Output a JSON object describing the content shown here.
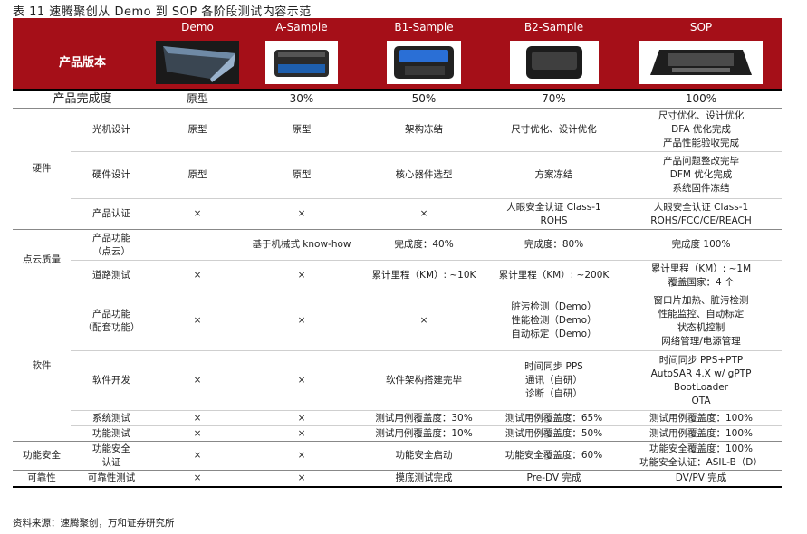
{
  "title": "表 11   速腾聚创从 Demo 到 SOP 各阶段测试内容示范",
  "header": {
    "corner": "产品版本",
    "versions": [
      "Demo",
      "A-Sample",
      "B1-Sample",
      "B2-Sample",
      "SOP"
    ]
  },
  "completion": {
    "label": "产品完成度",
    "values": [
      "原型",
      "30%",
      "50%",
      "70%",
      "100%"
    ]
  },
  "groups": {
    "hardware": "硬件",
    "pointcloud": "点云质量",
    "software": "软件",
    "safety": "功能安全",
    "reliability": "可靠性"
  },
  "rows": {
    "optical": {
      "label": "光机设计",
      "c": [
        "原型",
        "原型",
        "架构冻结",
        "尺寸优化、设计优化"
      ],
      "sop": [
        "尺寸优化、设计优化",
        "DFA 优化完成",
        "产品性能验收完成"
      ]
    },
    "hwdesign": {
      "label": "硬件设计",
      "c": [
        "原型",
        "原型",
        "核心器件选型",
        "方案冻结"
      ],
      "sop": [
        "产品问题整改完毕",
        "DFM 优化完成",
        "系统固件冻结"
      ]
    },
    "cert": {
      "label": "产品认证",
      "c": [
        "×",
        "×",
        "×"
      ],
      "b2": [
        "人眼安全认证 Class-1",
        "ROHS"
      ],
      "sop": [
        "人眼安全认证 Class-1",
        "ROHS/FCC/CE/REACH"
      ]
    },
    "pcfunc": {
      "label": [
        "产品功能",
        "（点云）"
      ],
      "c": [
        "",
        "基于机械式 know-how",
        "完成度：40%",
        "完成度：80%",
        "完成度 100%"
      ]
    },
    "road": {
      "label": "道路测试",
      "c": [
        "×",
        "×",
        "累计里程（KM）: ~10K",
        "累计里程（KM）: ~200K"
      ],
      "sop": [
        "累计里程（KM）: ~1M",
        "覆盖国家：4 个"
      ]
    },
    "swfunc": {
      "label": [
        "产品功能",
        "（配套功能）"
      ],
      "c": [
        "×",
        "×",
        "×"
      ],
      "b2": [
        "脏污检测（Demo）",
        "性能检测（Demo）",
        "自动标定（Demo）"
      ],
      "sop": [
        "窗口片加热、脏污检测",
        "性能监控、自动标定",
        "状态机控制",
        "网络管理/电源管理"
      ]
    },
    "swdev": {
      "label": "软件开发",
      "c": [
        "×",
        "×",
        "软件架构搭建完毕"
      ],
      "b2": [
        "时间同步 PPS",
        "通讯（自研）",
        "诊断（自研）"
      ],
      "sop": [
        "时间同步 PPS+PTP",
        "AutoSAR 4.X w/ gPTP",
        "BootLoader",
        "OTA"
      ]
    },
    "systest": {
      "label": "系统测试",
      "c": [
        "×",
        "×",
        "测试用例覆盖度：30%",
        "测试用例覆盖度：65%",
        "测试用例覆盖度：100%"
      ]
    },
    "functest": {
      "label": "功能测试",
      "c": [
        "×",
        "×",
        "测试用例覆盖度：10%",
        "测试用例覆盖度：50%",
        "测试用例覆盖度：100%"
      ]
    },
    "safety": {
      "label": [
        "功能安全",
        "认证"
      ],
      "c": [
        "×",
        "×",
        "功能安全启动",
        "功能安全覆盖度：60%"
      ],
      "sop": [
        "功能安全覆盖度：100%",
        "功能安全认证：ASIL-B（D）"
      ]
    },
    "reliab": {
      "label": "可靠性测试",
      "c": [
        "×",
        "×",
        "摸底测试完成",
        "Pre-DV 完成",
        "DV/PV 完成"
      ]
    }
  },
  "source": "资料来源：速腾聚创，万和证券研究所",
  "colors": {
    "header_bg": "#a50f18",
    "header_text": "#ffffff"
  }
}
